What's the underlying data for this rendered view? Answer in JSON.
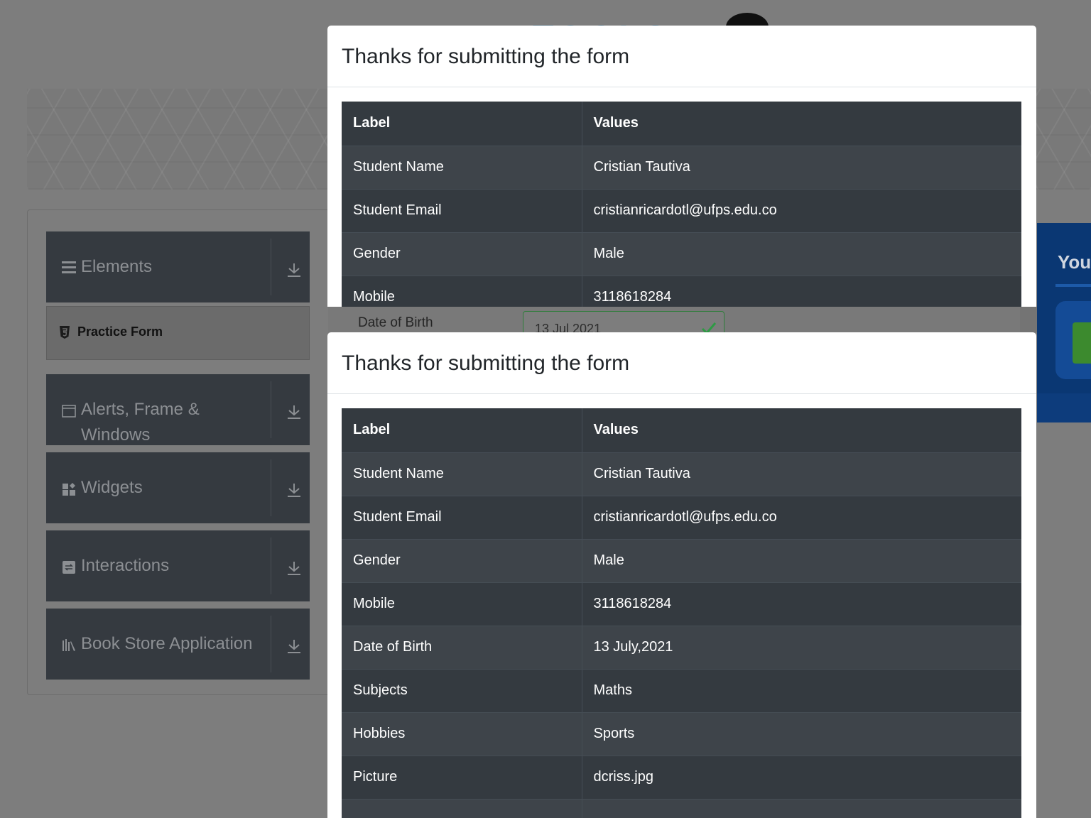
{
  "background": {
    "sidebar": {
      "groups": [
        {
          "label": "Elements",
          "icon": "list-icon"
        },
        {
          "label": "Alerts, Frame &",
          "label2": "Windows",
          "icon": "window-icon"
        },
        {
          "label": "Widgets",
          "icon": "widgets-icon"
        },
        {
          "label": "Interactions",
          "icon": "interactions-icon"
        },
        {
          "label": "Book Store Application",
          "icon": "books-icon"
        }
      ],
      "active_item": {
        "label": "Practice Form",
        "icon": "html5-icon"
      }
    },
    "form": {
      "dob_label": "Date of Birth",
      "dob_value": "13 Jul 2021"
    },
    "ad": {
      "title": "You"
    }
  },
  "modals": [
    {
      "title": "Thanks for submitting the form",
      "headers": [
        "Label",
        "Values"
      ],
      "rows": [
        [
          "Student Name",
          "Cristian Tautiva"
        ],
        [
          "Student Email",
          "cristianricardotl@ufps.edu.co"
        ],
        [
          "Gender",
          "Male"
        ],
        [
          "Mobile",
          "3118618284"
        ]
      ]
    },
    {
      "title": "Thanks for submitting the form",
      "headers": [
        "Label",
        "Values"
      ],
      "rows": [
        [
          "Student Name",
          "Cristian Tautiva"
        ],
        [
          "Student Email",
          "cristianricardotl@ufps.edu.co"
        ],
        [
          "Gender",
          "Male"
        ],
        [
          "Mobile",
          "3118618284"
        ],
        [
          "Date of Birth",
          "13 July,2021"
        ],
        [
          "Subjects",
          "Maths"
        ],
        [
          "Hobbies",
          "Sports"
        ],
        [
          "Picture",
          "dcriss.jpg"
        ]
      ]
    }
  ]
}
